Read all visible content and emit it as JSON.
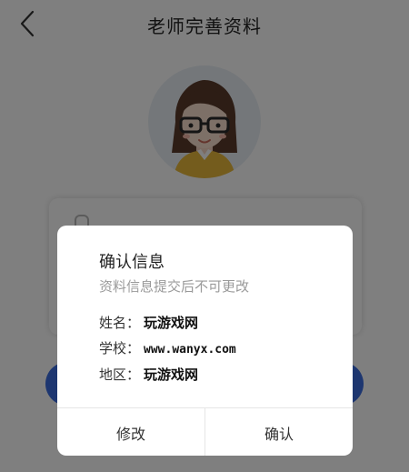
{
  "nav": {
    "title": "老师完善资料",
    "back_icon": "chevron-left-icon"
  },
  "avatar": {
    "icon": "teacher-avatar-icon",
    "background": "#e9eef5"
  },
  "form": {
    "field_icon": "user-icon"
  },
  "dialog": {
    "title": "确认信息",
    "subtitle": "资料信息提交后不可更改",
    "fields": [
      {
        "label": "姓名：",
        "value": "玩游戏网"
      },
      {
        "label": "学校：",
        "value": "www.wanyx.com"
      },
      {
        "label": "地区：",
        "value": "玩游戏网"
      }
    ],
    "cancel_label": "修改",
    "confirm_label": "确认"
  },
  "colors": {
    "accent": "#3b6de0",
    "overlay": "rgba(0,0,0,0.5)",
    "subtitle": "#9a9a9a"
  }
}
